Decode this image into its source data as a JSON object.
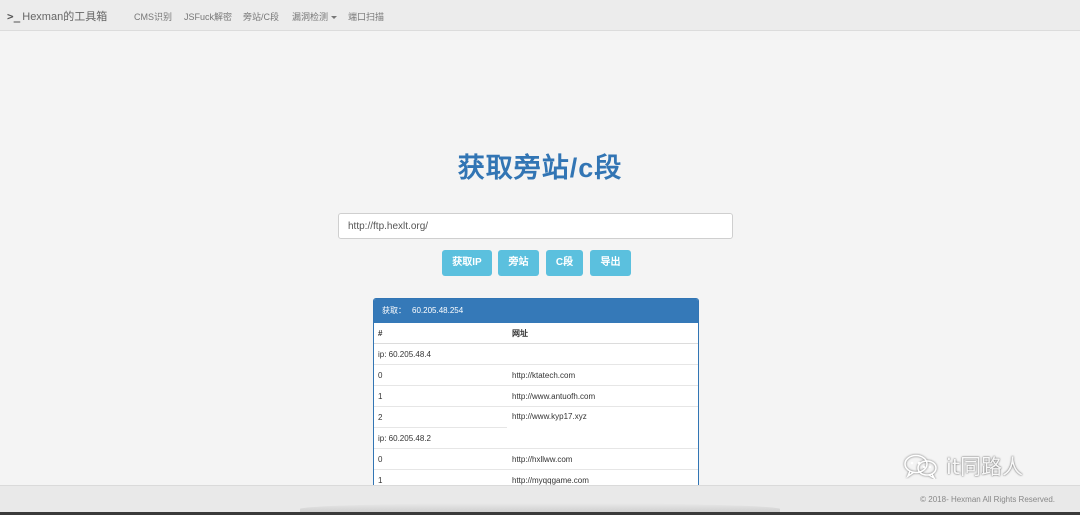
{
  "navbar": {
    "brand_icon": ">_",
    "brand": "Hexman的工具箱",
    "items": [
      {
        "label": "CMS识别"
      },
      {
        "label": "JSFuck解密"
      },
      {
        "label": "旁站/C段"
      },
      {
        "label": "漏洞检测"
      },
      {
        "label": "端口扫描"
      }
    ]
  },
  "main": {
    "title": "获取旁站/c段",
    "url_value": "http://ftp.hexlt.org/",
    "buttons": [
      {
        "label": "获取IP"
      },
      {
        "label": "旁站"
      },
      {
        "label": "C段"
      },
      {
        "label": "导出"
      }
    ]
  },
  "panel": {
    "heading_label": "获取：",
    "heading_ip": "60.205.48.254",
    "col_index": "#",
    "col_url": "网址",
    "groups": [
      {
        "ip": "ip: 60.205.48.4",
        "rows": [
          {
            "index": "0",
            "url": "http://ktatech.com"
          },
          {
            "index": "1",
            "url": "http://www.antuofh.com"
          },
          {
            "index": "2",
            "url": "http://www.kyp17.xyz"
          }
        ]
      },
      {
        "ip": "ip: 60.205.48.2",
        "rows": [
          {
            "index": "0",
            "url": "http://hxllww.com"
          },
          {
            "index": "1",
            "url": "http://myqqgame.com"
          }
        ]
      }
    ]
  },
  "footer": {
    "copyright": "© 2018- Hexman All Rights Reserved."
  },
  "watermark": {
    "text": "it同路人",
    "icon": "wechat-icon"
  },
  "colors": {
    "accent": "#3275b4",
    "button": "#5bc0de",
    "panel_heading": "#3579b8"
  }
}
